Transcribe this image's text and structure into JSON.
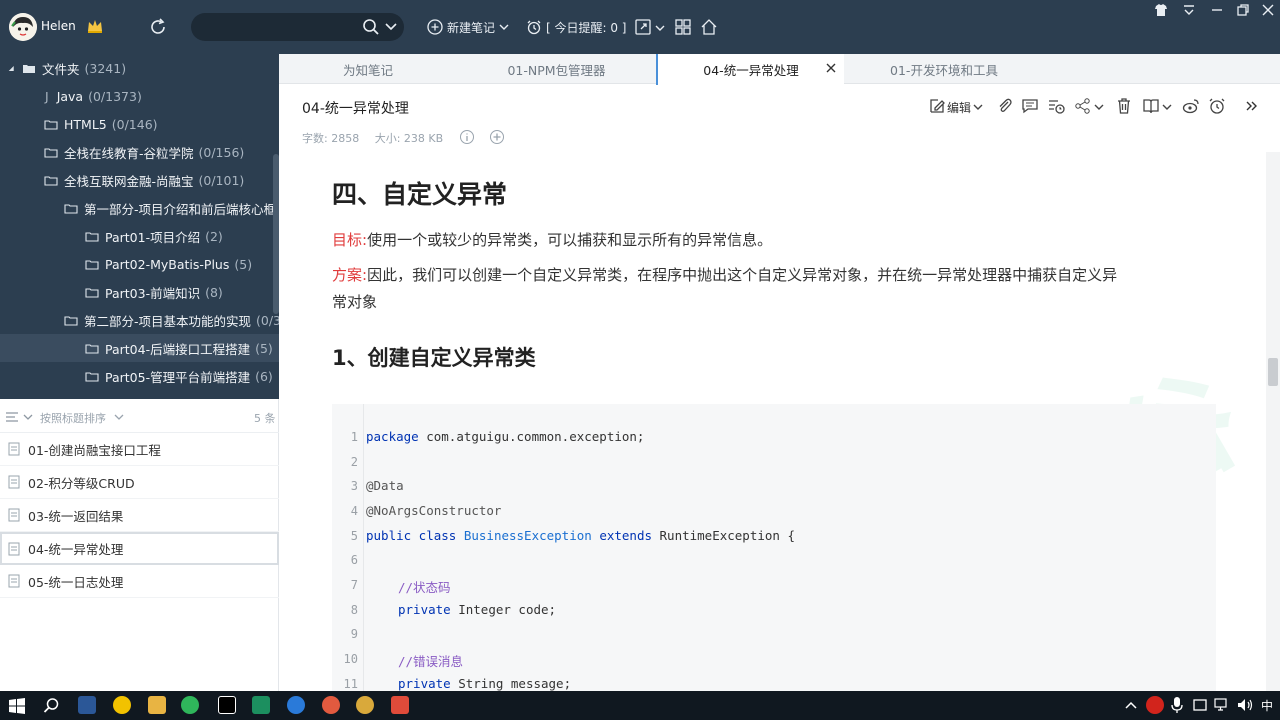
{
  "topbar": {
    "user_name": "Helen",
    "new_note_label": "新建笔记",
    "reminder_label": "[ 今日提醒: 0 ]"
  },
  "tree": {
    "items": [
      {
        "label": "文件夹",
        "count": "(3241)"
      },
      {
        "label": "Java",
        "count": "(0/1373)"
      },
      {
        "label": "HTML5",
        "count": "(0/146)"
      },
      {
        "label": "全栈在线教育-谷粒学院",
        "count": "(0/156)"
      },
      {
        "label": "全栈互联网金融-尚融宝",
        "count": "(0/101)"
      },
      {
        "label": "第一部分-项目介绍和前后端核心框架",
        "count": ""
      },
      {
        "label": "Part01-项目介绍",
        "count": "(2)"
      },
      {
        "label": "Part02-MyBatis-Plus",
        "count": "(5)"
      },
      {
        "label": "Part03-前端知识",
        "count": "(8)"
      },
      {
        "label": "第二部分-项目基本功能的实现",
        "count": "(0/3"
      },
      {
        "label": "Part04-后端接口工程搭建",
        "count": "(5)"
      },
      {
        "label": "Part05-管理平台前端搭建",
        "count": "(6)"
      }
    ]
  },
  "list": {
    "sort_label": "按照标题排序",
    "count_label": "5 条",
    "notes": [
      "01-创建尚融宝接口工程",
      "02-积分等级CRUD",
      "03-统一返回结果",
      "04-统一异常处理",
      "05-统一日志处理"
    ]
  },
  "tabs": [
    "为知笔记",
    "01-NPM包管理器",
    "04-统一异常处理",
    "01-开发环境和工具"
  ],
  "note": {
    "title": "04-统一异常处理",
    "word_count": "字数: 2858",
    "size": "大小: 238 KB",
    "edit_label": "编辑"
  },
  "content": {
    "heading": "四、自定义异常",
    "goal_tag": "目标:",
    "goal_text": "使用一个或较少的异常类，可以捕获和显示所有的异常信息。",
    "plan_tag": "方案:",
    "plan_text_1": "因此，我们可以创建一个自定义异常类，在程序中抛出这个自定义异常对象，并在统一异常处理器中捕获自定义异",
    "plan_text_2": "常对象",
    "subheading": "1、创建自定义异常类",
    "watermark": "硅谷"
  },
  "code": {
    "line_numbers": [
      "1",
      "2",
      "3",
      "4",
      "5",
      "6",
      "7",
      "8",
      "9",
      "10",
      "11"
    ],
    "l1_kw": "package",
    "l1_rest": " com.atguigu.common.exception;",
    "l3": "@Data",
    "l4": "@NoArgsConstructor",
    "l5_kw1": "public class",
    "l5_cls": "BusinessException",
    "l5_kw2": "extends",
    "l5_rest": " RuntimeException {",
    "l7": "//状态码",
    "l8_kw": "private",
    "l8_rest": " Integer code;",
    "l10": "//错误消息",
    "l11_kw": "private",
    "l11_rest": " String message;"
  },
  "taskbar": {
    "ime": "中"
  },
  "colors": {
    "sidebar_bg": "#2c3e50",
    "accent_red": "#e03c3c",
    "keyword_blue": "#0033b3",
    "active_tab_border": "#4a90d9"
  }
}
